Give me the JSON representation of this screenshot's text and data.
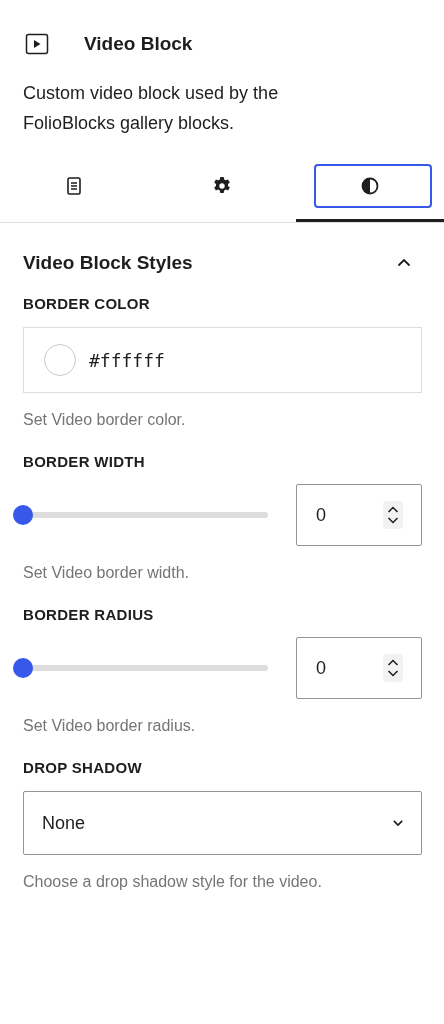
{
  "block": {
    "title": "Video Block",
    "description": "Custom video block used by the FolioBlocks gallery blocks."
  },
  "tabs": [
    {
      "kind": "list",
      "selected": false
    },
    {
      "kind": "gear",
      "selected": false
    },
    {
      "kind": "contrast",
      "selected": true
    }
  ],
  "panel": {
    "title": "Video Block Styles",
    "expanded": true,
    "controls": [
      {
        "kind": "color",
        "label": "BORDER COLOR",
        "value": "#ffffff",
        "help": "Set Video border color."
      },
      {
        "kind": "range",
        "label": "BORDER WIDTH",
        "level": 0,
        "value": "0",
        "help": "Set Video border width."
      },
      {
        "kind": "range",
        "label": "BORDER RADIUS",
        "level": 0,
        "value": "0",
        "help": "Set Video border radius."
      },
      {
        "kind": "select",
        "label": "DROP SHADOW",
        "value": "None",
        "help": "Choose a drop shadow style for the video."
      }
    ]
  }
}
